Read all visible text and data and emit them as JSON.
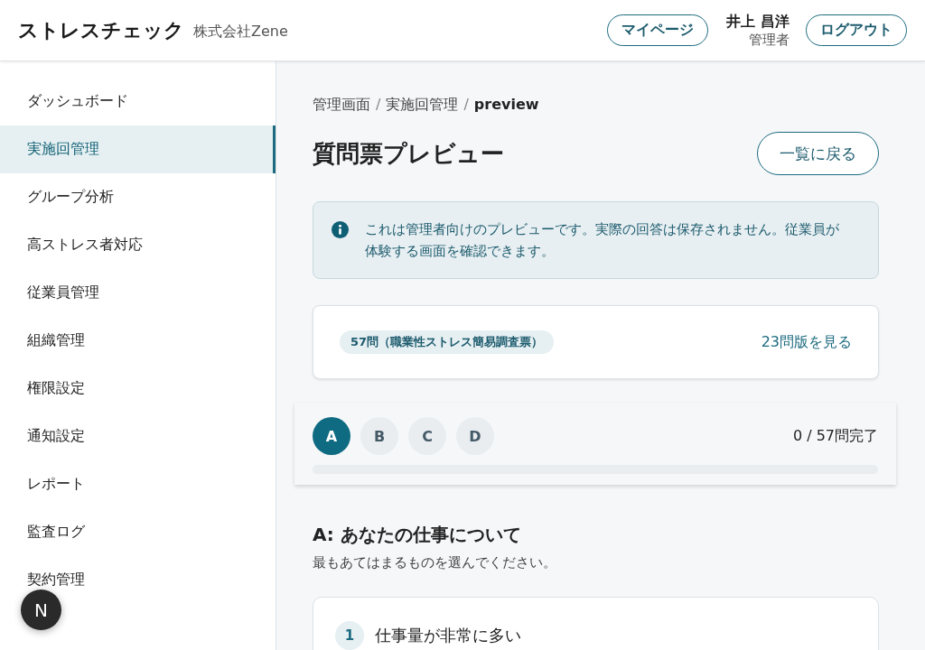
{
  "header": {
    "app_title": "ストレスチェック",
    "company": "株式会社Zene",
    "mypage_button": "マイページ",
    "user_name": "井上 昌洋",
    "user_role": "管理者",
    "logout_button": "ログアウト"
  },
  "sidebar": {
    "items": [
      {
        "label": "ダッシュボード",
        "selected": false
      },
      {
        "label": "実施回管理",
        "selected": true
      },
      {
        "label": "グループ分析",
        "selected": false
      },
      {
        "label": "高ストレス者対応",
        "selected": false
      },
      {
        "label": "従業員管理",
        "selected": false
      },
      {
        "label": "組織管理",
        "selected": false
      },
      {
        "label": "権限設定",
        "selected": false
      },
      {
        "label": "通知設定",
        "selected": false
      },
      {
        "label": "レポート",
        "selected": false
      },
      {
        "label": "監査ログ",
        "selected": false
      },
      {
        "label": "契約管理",
        "selected": false
      }
    ]
  },
  "floating_badge": "N",
  "breadcrumb_separator": "/",
  "breadcrumb": [
    {
      "label": "管理画面",
      "current": false
    },
    {
      "label": "実施回管理",
      "current": false
    },
    {
      "label": "preview",
      "current": true
    }
  ],
  "page_title": "質問票プレビュー",
  "back_button": "一覧に戻る",
  "notice": "これは管理者向けのプレビューです。実際の回答は保存されません。従業員が体験する画面を確認できます。",
  "version_card": {
    "tag": "57問（職業性ストレス簡易調査票）",
    "link": "23問版を見る"
  },
  "progress": {
    "sections": [
      {
        "label": "A",
        "selected": true
      },
      {
        "label": "B",
        "selected": false
      },
      {
        "label": "C",
        "selected": false
      },
      {
        "label": "D",
        "selected": false
      }
    ],
    "status": "0 / 57問完了",
    "level": 0
  },
  "section": {
    "title": "A: あなたの仕事について",
    "instruction": "最もあてはまるものを選んでください。"
  },
  "questions": [
    {
      "number": "1",
      "text": "仕事量が非常に多い"
    }
  ]
}
